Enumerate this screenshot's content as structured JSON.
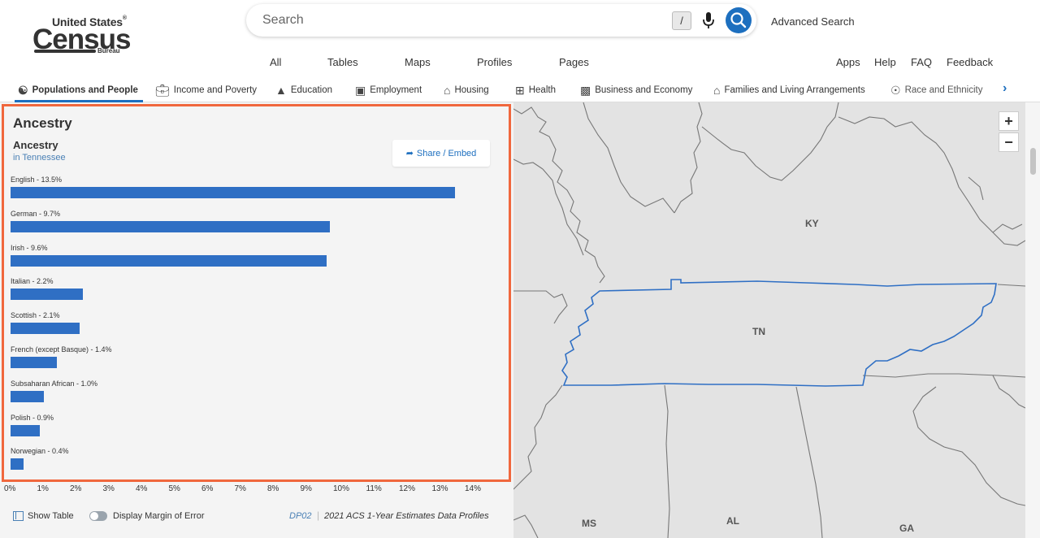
{
  "brand": {
    "line1": "United States",
    "line2": "Census",
    "line3": "Bureau",
    "reg": "®"
  },
  "search": {
    "placeholder": "Search",
    "slash": "/",
    "advanced": "Advanced Search"
  },
  "nav_left": [
    "All",
    "Tables",
    "Maps",
    "Profiles",
    "Pages"
  ],
  "nav_right": [
    "Apps",
    "Help",
    "FAQ",
    "Feedback"
  ],
  "categories": [
    {
      "label": "Populations and People",
      "icon": "people-icon",
      "active": true
    },
    {
      "label": "Income and Poverty",
      "icon": "briefcase-icon"
    },
    {
      "label": "Education",
      "icon": "graduation-cap-icon"
    },
    {
      "label": "Employment",
      "icon": "toolbox-icon"
    },
    {
      "label": "Housing",
      "icon": "houses-icon"
    },
    {
      "label": "Health",
      "icon": "medical-kit-icon"
    },
    {
      "label": "Business and Economy",
      "icon": "building-icon"
    },
    {
      "label": "Families and Living Arrangements",
      "icon": "family-home-icon"
    },
    {
      "label": "Race and Ethnicity",
      "icon": "globe-icon"
    }
  ],
  "panel": {
    "title": "Ancestry",
    "chart_title": "Ancestry",
    "chart_subtitle": "in Tennessee",
    "share_label": "Share / Embed",
    "show_table": "Show Table",
    "margin_of_error": "Display Margin of Error",
    "dataset_code": "DP02",
    "dataset_desc": "2021 ACS 1-Year Estimates Data Profiles"
  },
  "chart_data": {
    "type": "bar",
    "orientation": "horizontal",
    "title": "Ancestry",
    "subtitle": "in Tennessee",
    "unit": "%",
    "categories": [
      "English",
      "German",
      "Irish",
      "Italian",
      "Scottish",
      "French (except Basque)",
      "Subsaharan African",
      "Polish",
      "Norwegian"
    ],
    "values": [
      13.5,
      9.7,
      9.6,
      2.2,
      2.1,
      1.4,
      1.0,
      0.9,
      0.4
    ],
    "bar_labels": [
      "English - 13.5%",
      "German - 9.7%",
      "Irish - 9.6%",
      "Italian - 2.2%",
      "Scottish - 2.1%",
      "French (except Basque) - 1.4%",
      "Subsaharan African - 1.0%",
      "Polish - 0.9%",
      "Norwegian - 0.4%"
    ],
    "xticks": [
      "0%",
      "1%",
      "2%",
      "3%",
      "4%",
      "5%",
      "6%",
      "7%",
      "8%",
      "9%",
      "10%",
      "11%",
      "12%",
      "13%",
      "14%"
    ],
    "xlim": [
      0,
      14
    ],
    "bar_color": "#2f6fc4"
  },
  "map": {
    "labels": [
      "KY",
      "TN",
      "MS",
      "AL",
      "GA"
    ],
    "zoom_in": "+",
    "zoom_out": "−",
    "highlight_color": "#2f6fc4"
  },
  "colors": {
    "accent": "#1d6fbf",
    "highlight_border": "#f0673d"
  }
}
